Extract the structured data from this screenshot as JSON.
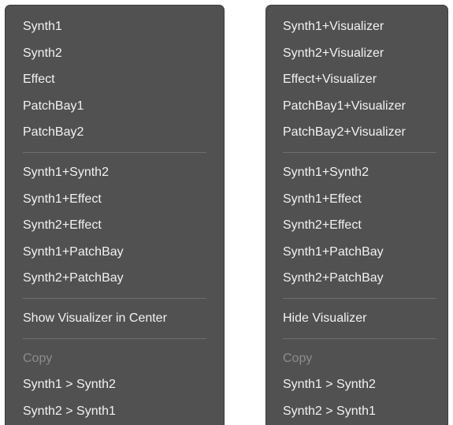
{
  "left_menu": {
    "group1": [
      "Synth1",
      "Synth2",
      "Effect",
      "PatchBay1",
      "PatchBay2"
    ],
    "group2": [
      "Synth1+Synth2",
      "Synth1+Effect",
      "Synth2+Effect",
      "Synth1+PatchBay",
      "Synth2+PatchBay"
    ],
    "visualizer_toggle": "Show Visualizer in Center",
    "copy_label": "Copy",
    "copy_options": [
      "Synth1 > Synth2",
      "Synth2 > Synth1"
    ]
  },
  "right_menu": {
    "group1": [
      "Synth1+Visualizer",
      "Synth2+Visualizer",
      "Effect+Visualizer",
      "PatchBay1+Visualizer",
      "PatchBay2+Visualizer"
    ],
    "group2": [
      "Synth1+Synth2",
      "Synth1+Effect",
      "Synth2+Effect",
      "Synth1+PatchBay",
      "Synth2+PatchBay"
    ],
    "visualizer_toggle": "Hide Visualizer",
    "copy_label": "Copy",
    "copy_options": [
      "Synth1 > Synth2",
      "Synth2 > Synth1"
    ]
  },
  "colors": {
    "menu_background": "#515151",
    "item_text": "#f2f2f2",
    "disabled_text": "#8c8c8c",
    "separator": "#6e6e6e"
  }
}
